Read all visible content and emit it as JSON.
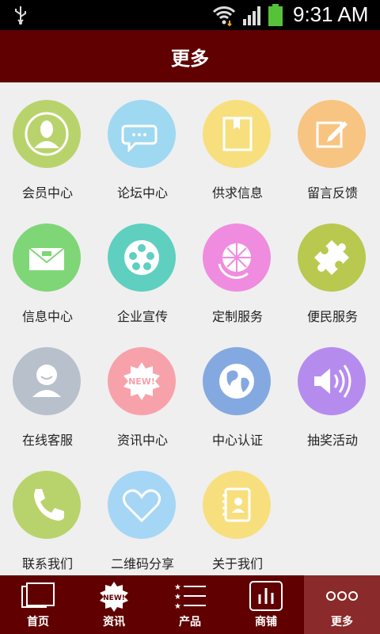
{
  "status_bar": {
    "time": "9:31 AM"
  },
  "header": {
    "title": "更多"
  },
  "grid": {
    "items": [
      {
        "label": "会员中心",
        "color": "#b9d36c",
        "icon": "member-icon"
      },
      {
        "label": "论坛中心",
        "color": "#9fd8f1",
        "icon": "chat-bubbles-icon"
      },
      {
        "label": "供求信息",
        "color": "#f8df7e",
        "icon": "book-icon"
      },
      {
        "label": "留言反馈",
        "color": "#f7c482",
        "icon": "edit-icon"
      },
      {
        "label": "信息中心",
        "color": "#7fd676",
        "icon": "mail-icon"
      },
      {
        "label": "企业宣传",
        "color": "#5fcfc0",
        "icon": "film-reel-icon"
      },
      {
        "label": "定制服务",
        "color": "#f08cdf",
        "icon": "globe-arrows-icon"
      },
      {
        "label": "便民服务",
        "color": "#b9c84f",
        "icon": "puzzle-icon"
      },
      {
        "label": "在线客服",
        "color": "#b8c0cc",
        "icon": "support-person-icon"
      },
      {
        "label": "资讯中心",
        "color": "#f7a2aa",
        "icon": "new-badge-icon"
      },
      {
        "label": "中心认证",
        "color": "#84a9e0",
        "icon": "globe-icon"
      },
      {
        "label": "抽奖活动",
        "color": "#b58cee",
        "icon": "speaker-icon"
      },
      {
        "label": "联系我们",
        "color": "#b9d36c",
        "icon": "phone-icon"
      },
      {
        "label": "二维码分享",
        "color": "#a5d6f5",
        "icon": "heart-icon"
      },
      {
        "label": "关于我们",
        "color": "#f8df7e",
        "icon": "contacts-book-icon"
      }
    ]
  },
  "tab_bar": {
    "tabs": [
      {
        "label": "首页",
        "icon": "home-windows-icon",
        "active": false
      },
      {
        "label": "资讯",
        "icon": "new-badge-icon",
        "active": false
      },
      {
        "label": "产品",
        "icon": "star-list-icon",
        "active": false
      },
      {
        "label": "商铺",
        "icon": "bar-chart-icon",
        "active": false
      },
      {
        "label": "更多",
        "icon": "more-dots-icon",
        "active": true
      }
    ]
  },
  "colors": {
    "header_bg": "#600000",
    "tab_active_bg": "#8a2a2a",
    "page_bg": "#efefef"
  }
}
